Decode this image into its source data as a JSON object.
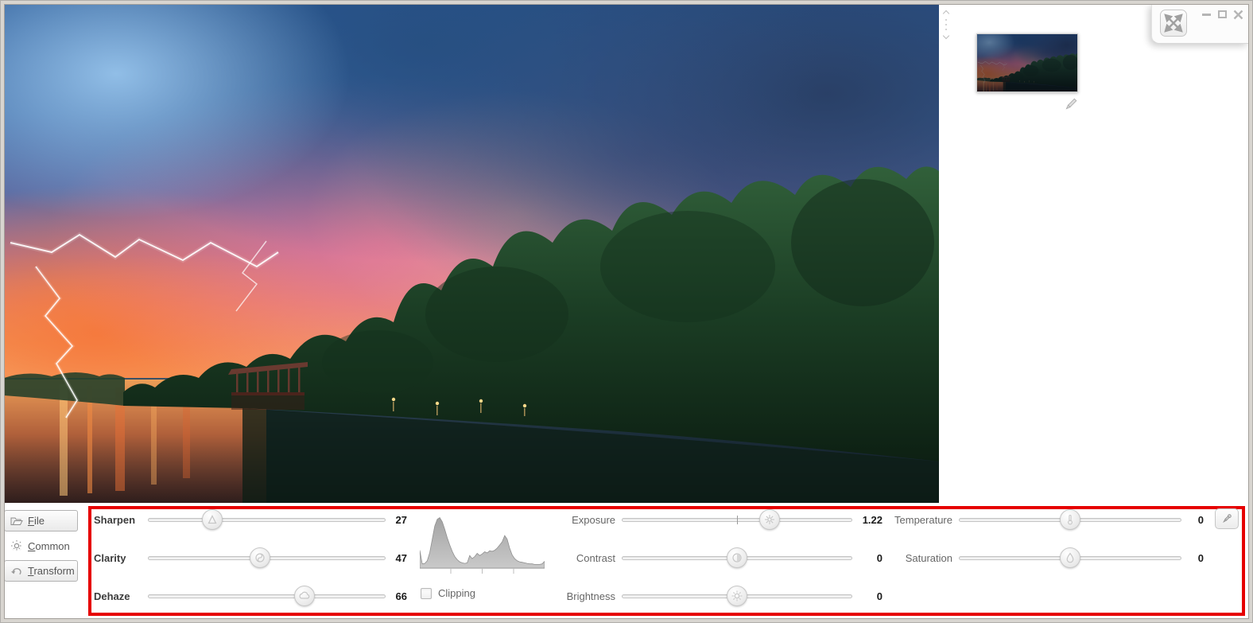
{
  "annotation_color": "#e60000",
  "window_controls": {
    "fullscreen_icon": "expand-arrows",
    "minimize_icon": "minimize-bar",
    "maximize_icon": "maximize-square",
    "close_icon": "close-x"
  },
  "right_panel": {
    "thumbnail": "sunset-lake-photo-thumbnail",
    "edit_icon": "pencil"
  },
  "sidebar": {
    "items": [
      {
        "id": "file",
        "label": "File",
        "icon": "folder-open-icon"
      },
      {
        "id": "common",
        "label": "Common",
        "icon": "sun-adjust-icon"
      },
      {
        "id": "transform",
        "label": "Transform",
        "icon": "undo-arrow-icon"
      }
    ]
  },
  "panel": {
    "sliders": {
      "sharpen": {
        "label": "Sharpen",
        "value": "27",
        "percent": 27,
        "icon": "sharpen-triangle-icon"
      },
      "clarity": {
        "label": "Clarity",
        "value": "47",
        "percent": 47,
        "icon": "clarity-swirl-icon"
      },
      "dehaze": {
        "label": "Dehaze",
        "value": "66",
        "percent": 66,
        "icon": "dehaze-cloud-icon"
      },
      "exposure": {
        "label": "Exposure",
        "value": "1.22",
        "percent": 64,
        "icon": "aperture-icon"
      },
      "contrast": {
        "label": "Contrast",
        "value": "0",
        "percent": 50,
        "icon": "contrast-half-circle-icon"
      },
      "brightness": {
        "label": "Brightness",
        "value": "0",
        "percent": 50,
        "icon": "brightness-sun-icon"
      },
      "temperature": {
        "label": "Temperature",
        "value": "0",
        "percent": 50,
        "icon": "thermometer-icon"
      },
      "saturation": {
        "label": "Saturation",
        "value": "0",
        "percent": 50,
        "icon": "droplet-icon"
      }
    },
    "clipping": {
      "label": "Clipping",
      "checked": false
    },
    "histogram": {
      "type": "area",
      "color": "#b3b3b3",
      "values": [
        34,
        8,
        9,
        14,
        30,
        55,
        80,
        93,
        96,
        88,
        74,
        58,
        44,
        32,
        22,
        16,
        12,
        10,
        9,
        10,
        24,
        18,
        22,
        28,
        24,
        27,
        31,
        29,
        33,
        32,
        34,
        38,
        44,
        50,
        62,
        55,
        38,
        25,
        18,
        14,
        12,
        11,
        10,
        9,
        8,
        8,
        7,
        7,
        7,
        8,
        13
      ]
    }
  }
}
